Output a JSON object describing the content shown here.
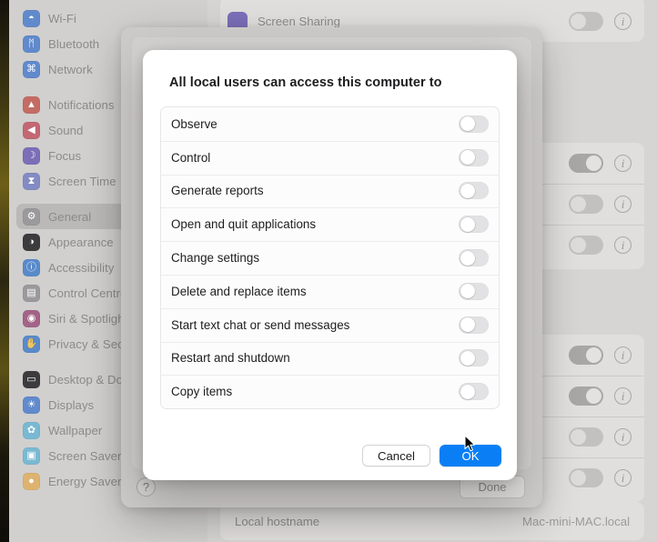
{
  "dialog": {
    "title": "All local users can access this computer to",
    "permissions": [
      {
        "label": "Observe",
        "enabled": false
      },
      {
        "label": "Control",
        "enabled": false
      },
      {
        "label": "Generate reports",
        "enabled": false
      },
      {
        "label": "Open and quit applications",
        "enabled": false
      },
      {
        "label": "Change settings",
        "enabled": false
      },
      {
        "label": "Delete and replace items",
        "enabled": false
      },
      {
        "label": "Start text chat or send messages",
        "enabled": false
      },
      {
        "label": "Restart and shutdown",
        "enabled": false
      },
      {
        "label": "Copy items",
        "enabled": false
      }
    ],
    "cancel_label": "Cancel",
    "ok_label": "OK",
    "ok_color": "#0a7ff5"
  },
  "sheet": {
    "done_label": "Done",
    "help_glyph": "?"
  },
  "sidebar": {
    "items": [
      {
        "label": "Wi-Fi",
        "icon": "wifi-icon",
        "color": "#4a8cf7",
        "glyph": "◓",
        "selected": false
      },
      {
        "label": "Bluetooth",
        "icon": "bluetooth-icon",
        "color": "#4a8cf7",
        "glyph": "ᛗ",
        "selected": false
      },
      {
        "label": "Network",
        "icon": "network-icon",
        "color": "#4a8cf7",
        "glyph": "⌘",
        "selected": false
      },
      {
        "label": "",
        "icon": "spacer",
        "color": "",
        "glyph": "",
        "selected": false
      },
      {
        "label": "Notifications",
        "icon": "notifications-icon",
        "color": "#ef6152",
        "glyph": "▲",
        "selected": false
      },
      {
        "label": "Sound",
        "icon": "sound-icon",
        "color": "#ef5a6e",
        "glyph": "◀",
        "selected": false
      },
      {
        "label": "Focus",
        "icon": "focus-icon",
        "color": "#7d6ae0",
        "glyph": "☽",
        "selected": false
      },
      {
        "label": "Screen Time",
        "icon": "screen-time-icon",
        "color": "#7d8ae5",
        "glyph": "⧗",
        "selected": false
      },
      {
        "label": "",
        "icon": "spacer",
        "color": "",
        "glyph": "",
        "selected": false
      },
      {
        "label": "General",
        "icon": "general-icon",
        "color": "#9a9a9f",
        "glyph": "⚙",
        "selected": true
      },
      {
        "label": "Appearance",
        "icon": "appearance-icon",
        "color": "#3c3c41",
        "glyph": "◑",
        "selected": false
      },
      {
        "label": "Accessibility",
        "icon": "accessibility-icon",
        "color": "#3f8df5",
        "glyph": "ⓘ",
        "selected": false
      },
      {
        "label": "Control Centre",
        "icon": "control-centre-icon",
        "color": "#9a9a9f",
        "glyph": "▤",
        "selected": false
      },
      {
        "label": "Siri & Spotlight",
        "icon": "siri-icon",
        "color": "#c05a93",
        "glyph": "◉",
        "selected": false
      },
      {
        "label": "Privacy & Security",
        "icon": "privacy-icon",
        "color": "#3f8df5",
        "glyph": "✋",
        "selected": false
      },
      {
        "label": "",
        "icon": "spacer",
        "color": "",
        "glyph": "",
        "selected": false
      },
      {
        "label": "Desktop & Dock",
        "icon": "desktop-dock-icon",
        "color": "#3c3c41",
        "glyph": "▭",
        "selected": false
      },
      {
        "label": "Displays",
        "icon": "displays-icon",
        "color": "#4a8cf7",
        "glyph": "☀",
        "selected": false
      },
      {
        "label": "Wallpaper",
        "icon": "wallpaper-icon",
        "color": "#5ac0e8",
        "glyph": "✿",
        "selected": false
      },
      {
        "label": "Screen Saver",
        "icon": "screen-saver-icon",
        "color": "#5ac0e8",
        "glyph": "▣",
        "selected": false
      },
      {
        "label": "Energy Saver",
        "icon": "energy-saver-icon",
        "color": "#f5b043",
        "glyph": "●",
        "selected": false
      }
    ]
  },
  "background": {
    "top_row": {
      "label": "Screen Sharing",
      "icon_color": "#7d6ae0",
      "enabled": false
    },
    "group_one": [
      {
        "enabled": true
      },
      {
        "enabled": false
      },
      {
        "enabled": false
      }
    ],
    "group_two": [
      {
        "enabled": true
      },
      {
        "enabled": true
      },
      {
        "enabled": false
      },
      {
        "enabled": false
      }
    ],
    "hostname_label": "Local hostname",
    "hostname_value": "Mac-mini-MAC.local"
  }
}
